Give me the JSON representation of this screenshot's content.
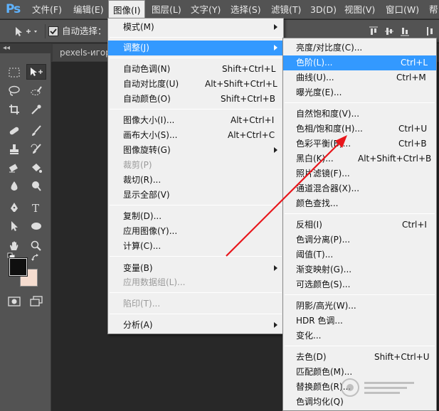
{
  "app": {
    "logo": "Ps"
  },
  "menubar": {
    "items": [
      {
        "label": "文件(F)"
      },
      {
        "label": "编辑(E)"
      },
      {
        "label": "图像(I)"
      },
      {
        "label": "图层(L)"
      },
      {
        "label": "文字(Y)"
      },
      {
        "label": "选择(S)"
      },
      {
        "label": "滤镜(T)"
      },
      {
        "label": "3D(D)"
      },
      {
        "label": "视图(V)"
      },
      {
        "label": "窗口(W)"
      },
      {
        "label": "帮"
      }
    ],
    "active_index": 2
  },
  "options_bar": {
    "auto_select_label": "自动选择：",
    "auto_select_checked": true
  },
  "toolbar": {
    "header": "◂◂",
    "foreground_color": "#0f0f0f",
    "background_color": "#f5dccf"
  },
  "document_tab": {
    "label": "pexels-игоре"
  },
  "image_menu": {
    "items": [
      {
        "label": "模式(M)",
        "shortcut": "",
        "submenu": true,
        "disabled": false
      },
      {
        "label": "调整(J)",
        "shortcut": "",
        "submenu": true,
        "disabled": false,
        "highlighted": true
      },
      {
        "label": "自动色调(N)",
        "shortcut": "Shift+Ctrl+L",
        "submenu": false,
        "disabled": false
      },
      {
        "label": "自动对比度(U)",
        "shortcut": "Alt+Shift+Ctrl+L",
        "submenu": false,
        "disabled": false
      },
      {
        "label": "自动颜色(O)",
        "shortcut": "Shift+Ctrl+B",
        "submenu": false,
        "disabled": false
      },
      {
        "label": "图像大小(I)...",
        "shortcut": "Alt+Ctrl+I",
        "submenu": false,
        "disabled": false
      },
      {
        "label": "画布大小(S)...",
        "shortcut": "Alt+Ctrl+C",
        "submenu": false,
        "disabled": false
      },
      {
        "label": "图像旋转(G)",
        "shortcut": "",
        "submenu": true,
        "disabled": false
      },
      {
        "label": "裁剪(P)",
        "shortcut": "",
        "submenu": false,
        "disabled": true
      },
      {
        "label": "裁切(R)...",
        "shortcut": "",
        "submenu": false,
        "disabled": false
      },
      {
        "label": "显示全部(V)",
        "shortcut": "",
        "submenu": false,
        "disabled": false
      },
      {
        "label": "复制(D)...",
        "shortcut": "",
        "submenu": false,
        "disabled": false
      },
      {
        "label": "应用图像(Y)...",
        "shortcut": "",
        "submenu": false,
        "disabled": false
      },
      {
        "label": "计算(C)...",
        "shortcut": "",
        "submenu": false,
        "disabled": false
      },
      {
        "label": "变量(B)",
        "shortcut": "",
        "submenu": true,
        "disabled": false
      },
      {
        "label": "应用数据组(L)...",
        "shortcut": "",
        "submenu": false,
        "disabled": true
      },
      {
        "label": "陷印(T)...",
        "shortcut": "",
        "submenu": false,
        "disabled": true
      },
      {
        "label": "分析(A)",
        "shortcut": "",
        "submenu": true,
        "disabled": false
      }
    ]
  },
  "adjust_menu": {
    "items": [
      {
        "label": "亮度/对比度(C)...",
        "shortcut": ""
      },
      {
        "label": "色阶(L)...",
        "shortcut": "Ctrl+L",
        "highlighted": true
      },
      {
        "label": "曲线(U)...",
        "shortcut": "Ctrl+M"
      },
      {
        "label": "曝光度(E)...",
        "shortcut": ""
      },
      {
        "label": "自然饱和度(V)...",
        "shortcut": ""
      },
      {
        "label": "色相/饱和度(H)...",
        "shortcut": "Ctrl+U"
      },
      {
        "label": "色彩平衡(B)...",
        "shortcut": "Ctrl+B"
      },
      {
        "label": "黑白(K)...",
        "shortcut": "Alt+Shift+Ctrl+B"
      },
      {
        "label": "照片滤镜(F)...",
        "shortcut": ""
      },
      {
        "label": "通道混合器(X)...",
        "shortcut": ""
      },
      {
        "label": "颜色查找...",
        "shortcut": ""
      },
      {
        "label": "反相(I)",
        "shortcut": "Ctrl+I"
      },
      {
        "label": "色调分离(P)...",
        "shortcut": ""
      },
      {
        "label": "阈值(T)...",
        "shortcut": ""
      },
      {
        "label": "渐变映射(G)...",
        "shortcut": ""
      },
      {
        "label": "可选颜色(S)...",
        "shortcut": ""
      },
      {
        "label": "阴影/高光(W)...",
        "shortcut": ""
      },
      {
        "label": "HDR 色调...",
        "shortcut": ""
      },
      {
        "label": "变化...",
        "shortcut": ""
      },
      {
        "label": "去色(D)",
        "shortcut": "Shift+Ctrl+U"
      },
      {
        "label": "匹配颜色(M)...",
        "shortcut": ""
      },
      {
        "label": "替换颜色(R)...",
        "shortcut": ""
      },
      {
        "label": "色调均化(Q)",
        "shortcut": ""
      }
    ]
  },
  "colors": {
    "highlight": "#3399ff",
    "annotation_arrow": "#e8161b"
  }
}
